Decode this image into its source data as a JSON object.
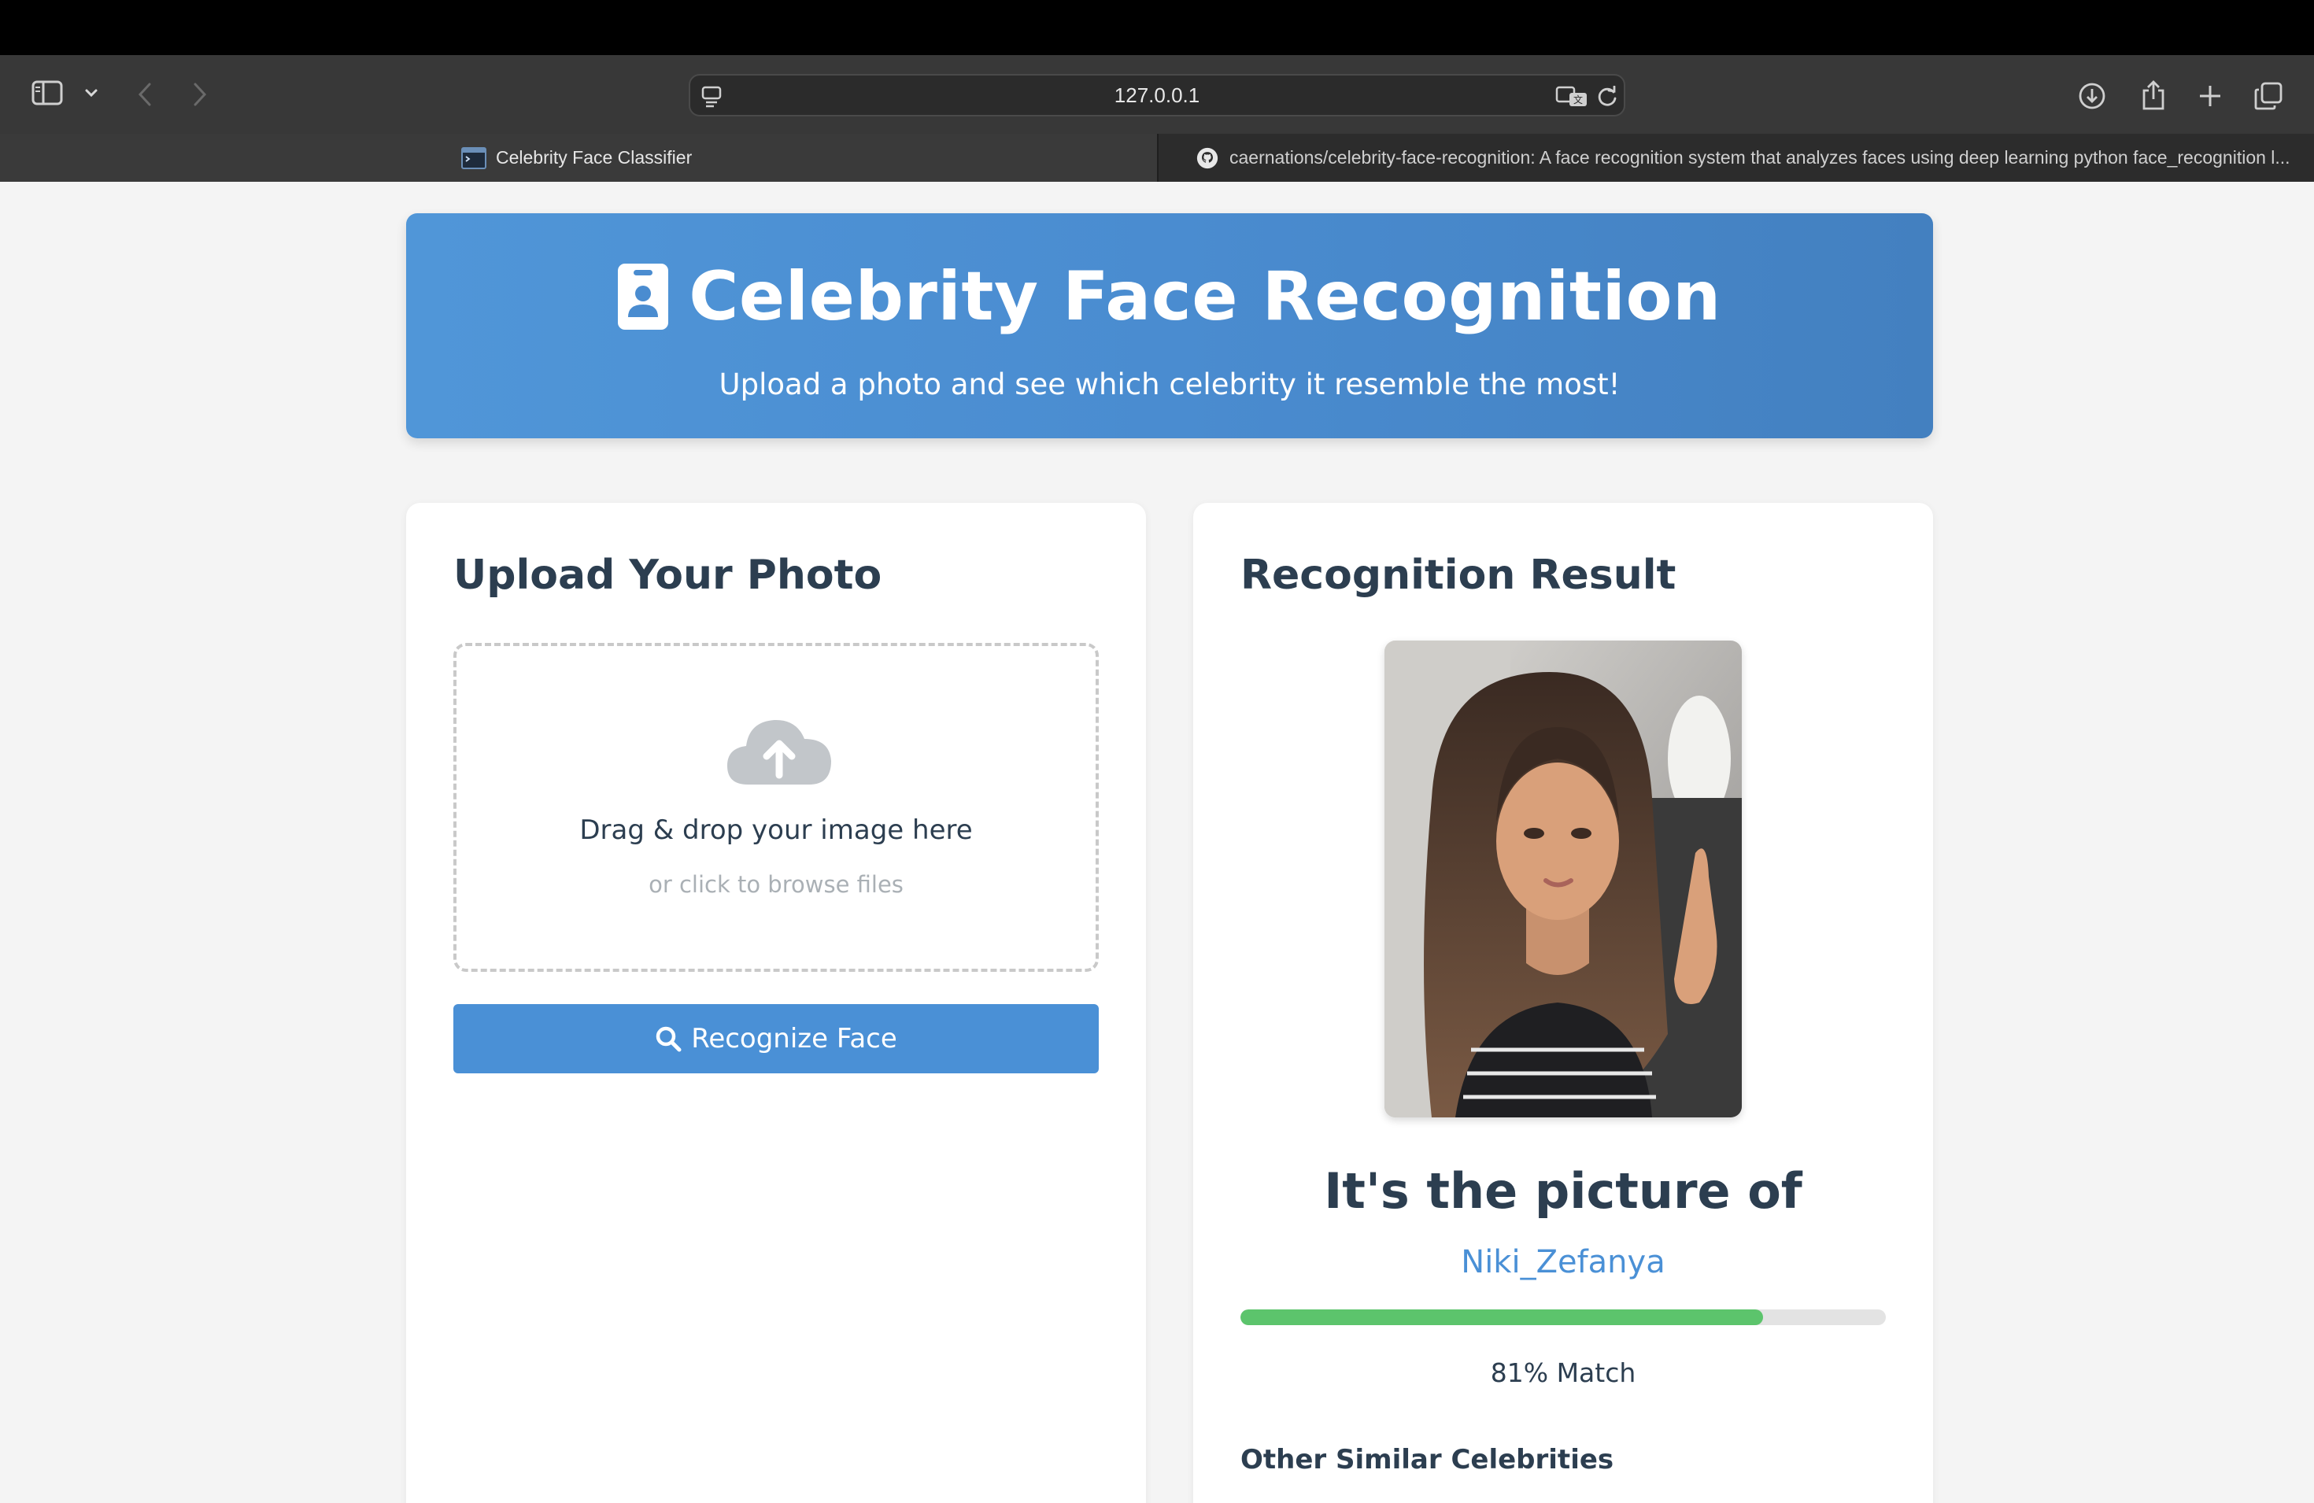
{
  "browser": {
    "address": "127.0.0.1",
    "tabs": [
      {
        "label": "Celebrity Face Classifier",
        "active": true
      },
      {
        "label": "caernations/celebrity-face-recognition: A face recognition system that analyzes faces using deep learning python face_recognition l...",
        "active": false
      }
    ]
  },
  "header": {
    "title": "Celebrity Face Recognition",
    "subtitle": "Upload a photo and see which celebrity it resemble the most!",
    "icon": "id-badge-icon"
  },
  "upload": {
    "title": "Upload Your Photo",
    "drop_text": "Drag & drop your image here",
    "browse_text": "or click to browse files",
    "button_label": "Recognize Face",
    "icons": [
      "cloud-upload-icon",
      "search-icon"
    ]
  },
  "result": {
    "title": "Recognition Result",
    "heading": "It's the picture of",
    "name": "Niki_Zefanya",
    "match_percent": 81,
    "match_text": "81% Match",
    "similar_heading": "Other Similar Celebrities"
  },
  "colors": {
    "accent": "#4a90d6",
    "match_bar": "#5cc46c",
    "heading_text": "#2c3e50"
  }
}
